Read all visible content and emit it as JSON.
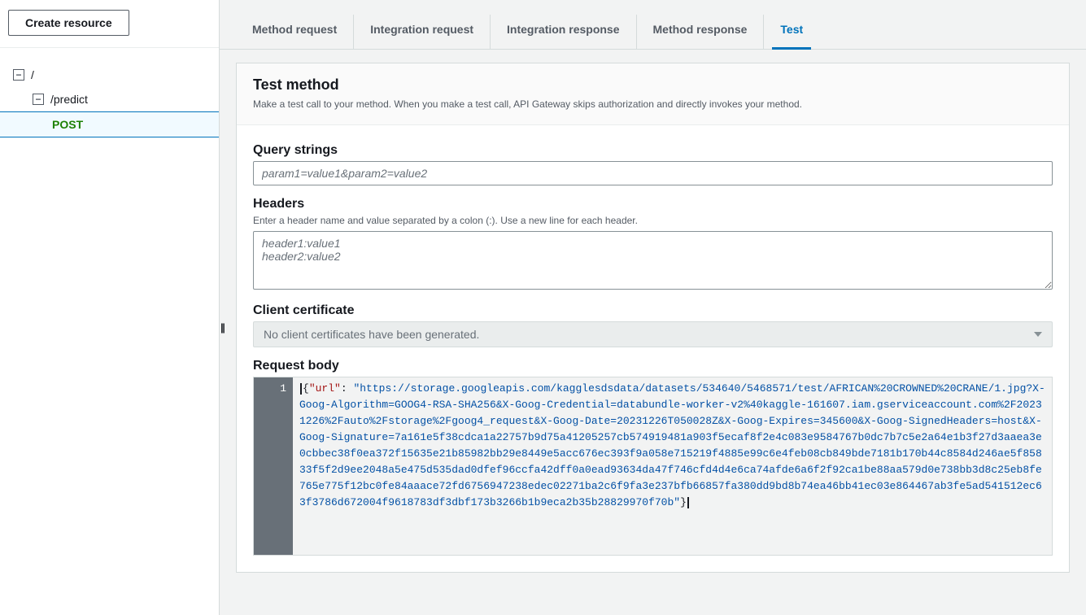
{
  "sidebar": {
    "create_resource_label": "Create resource",
    "root": {
      "label": "/"
    },
    "predict": {
      "label": "/predict"
    },
    "post": {
      "label": "POST"
    }
  },
  "tabs": {
    "method_request": "Method request",
    "integration_request": "Integration request",
    "integration_response": "Integration response",
    "method_response": "Method response",
    "test": "Test"
  },
  "panel": {
    "title": "Test method",
    "description": "Make a test call to your method. When you make a test call, API Gateway skips authorization and directly invokes your method."
  },
  "query_strings": {
    "label": "Query strings",
    "placeholder": "param1=value1&param2=value2",
    "value": ""
  },
  "headers": {
    "label": "Headers",
    "hint": "Enter a header name and value separated by a colon (:). Use a new line for each header.",
    "placeholder": "header1:value1\nheader2:value2",
    "value": ""
  },
  "client_certificate": {
    "label": "Client certificate",
    "selected": "No client certificates have been generated."
  },
  "request_body": {
    "label": "Request body",
    "line_number": "1",
    "json_key": "\"url\"",
    "json_value": "\"https://storage.googleapis.com/kagglesdsdata/datasets/534640/5468571/test/AFRICAN%20CROWNED%20CRANE/1.jpg?X-Goog-Algorithm=GOOG4-RSA-SHA256&X-Goog-Credential=databundle-worker-v2%40kaggle-161607.iam.gserviceaccount.com%2F20231226%2Fauto%2Fstorage%2Fgoog4_request&X-Goog-Date=20231226T050028Z&X-Goog-Expires=345600&X-Goog-SignedHeaders=host&X-Goog-Signature=7a161e5f38cdca1a22757b9d75a41205257cb574919481a903f5ecaf8f2e4c083e9584767b0dc7b7c5e2a64e1b3f27d3aaea3e0cbbec38f0ea372f15635e21b85982bb29e8449e5acc676ec393f9a058e715219f4885e99c6e4feb08cb849bde7181b170b44c8584d246ae5f85833f5f2d9ee2048a5e475d535dad0dfef96ccfa42dff0a0ead93634da47f746cfd4d4e6ca74afde6a6f2f92ca1be88aa579d0e738bb3d8c25eb8fe765e775f12bc0fe84aaace72fd6756947238edec02271ba2c6f9fa3e237bfb66857fa380dd9bd8b74ea46bb41ec03e864467ab3fe5ad541512ec63f3786d672004f9618783df3dbf173b3266b1b9eca2b35b28829970f70b\""
  }
}
